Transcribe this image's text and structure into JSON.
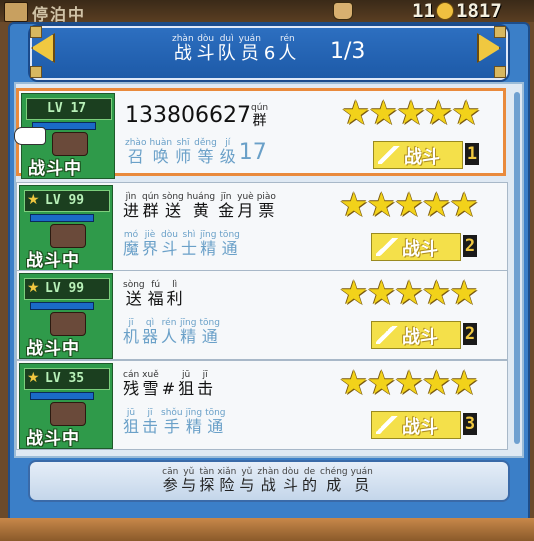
{
  "topbar": {
    "title": "停泊中",
    "count1": "11",
    "count2": "1817"
  },
  "header": {
    "title": [
      {
        "py": "zhàn",
        "hz": "战"
      },
      {
        "py": "dòu",
        "hz": "斗"
      },
      {
        "py": "duì",
        "hz": "队"
      },
      {
        "py": "yuán",
        "hz": "员"
      },
      {
        "py": "",
        "hz": "6"
      },
      {
        "py": "rén",
        "hz": "人"
      }
    ],
    "page": "1/3"
  },
  "members": [
    {
      "level": "LV 17",
      "battle_tag": "战斗中",
      "name_plain": "133806627",
      "name": [
        {
          "py": "qún",
          "hz": "群"
        }
      ],
      "job": [
        {
          "py": "zhào",
          "hz": "召"
        },
        {
          "py": "huàn",
          "hz": "唤"
        },
        {
          "py": "shī",
          "hz": "师"
        },
        {
          "py": "děng",
          "hz": "等"
        },
        {
          "py": "jí",
          "hz": "级"
        }
      ],
      "job_level": "17",
      "stars": 5,
      "fight_label": "战斗",
      "slot": "1",
      "selected": true
    },
    {
      "level": "LV 99",
      "battle_tag": "战斗中",
      "name_plain": "",
      "name": [
        {
          "py": "jìn",
          "hz": "进"
        },
        {
          "py": "qún",
          "hz": "群"
        },
        {
          "py": "sòng",
          "hz": "送"
        },
        {
          "py": "huáng",
          "hz": "黄"
        },
        {
          "py": "jīn",
          "hz": "金"
        },
        {
          "py": "yuè",
          "hz": "月"
        },
        {
          "py": "piào",
          "hz": "票"
        }
      ],
      "job": [
        {
          "py": "mó",
          "hz": "魔"
        },
        {
          "py": "jiè",
          "hz": "界"
        },
        {
          "py": "dòu",
          "hz": "斗"
        },
        {
          "py": "shì",
          "hz": "士"
        },
        {
          "py": "jīng",
          "hz": "精"
        },
        {
          "py": "tōng",
          "hz": "通"
        }
      ],
      "job_level": "",
      "stars": 5,
      "fight_label": "战斗",
      "slot": "2",
      "selected": false
    },
    {
      "level": "LV 99",
      "battle_tag": "战斗中",
      "name_plain": "",
      "name": [
        {
          "py": "sòng",
          "hz": "送"
        },
        {
          "py": "fú",
          "hz": "福"
        },
        {
          "py": "lì",
          "hz": "利"
        }
      ],
      "job": [
        {
          "py": "jī",
          "hz": "机"
        },
        {
          "py": "qì",
          "hz": "器"
        },
        {
          "py": "rén",
          "hz": "人"
        },
        {
          "py": "jīng",
          "hz": "精"
        },
        {
          "py": "tōng",
          "hz": "通"
        }
      ],
      "job_level": "",
      "stars": 5,
      "fight_label": "战斗",
      "slot": "2",
      "selected": false
    },
    {
      "level": "LV 35",
      "battle_tag": "战斗中",
      "name_plain": "",
      "name": [
        {
          "py": "cán",
          "hz": "残"
        },
        {
          "py": "xuě",
          "hz": "雪"
        },
        {
          "py": "",
          "hz": "#"
        },
        {
          "py": "jū",
          "hz": "狙"
        },
        {
          "py": "jī",
          "hz": "击"
        }
      ],
      "job": [
        {
          "py": "jū",
          "hz": "狙"
        },
        {
          "py": "jī",
          "hz": "击"
        },
        {
          "py": "shǒu",
          "hz": "手"
        },
        {
          "py": "jīng",
          "hz": "精"
        },
        {
          "py": "tōng",
          "hz": "通"
        }
      ],
      "job_level": "",
      "stars": 5,
      "fight_label": "战斗",
      "slot": "3",
      "selected": false
    }
  ],
  "footer": [
    {
      "py": "cān",
      "hz": "参"
    },
    {
      "py": "yǔ",
      "hz": "与"
    },
    {
      "py": "tàn",
      "hz": "探"
    },
    {
      "py": "xiǎn",
      "hz": "险"
    },
    {
      "py": "yǔ",
      "hz": "与"
    },
    {
      "py": "zhàn",
      "hz": "战"
    },
    {
      "py": "dòu",
      "hz": "斗"
    },
    {
      "py": "de",
      "hz": "的"
    },
    {
      "py": "chéng",
      "hz": "成"
    },
    {
      "py": "yuán",
      "hz": "员"
    }
  ],
  "icons": {
    "prev": "arrow-left-icon",
    "next": "arrow-right-icon",
    "star": "star-icon",
    "sword": "sword-icon",
    "pointer": "hand-pointer-icon"
  },
  "colors": {
    "frame": "#3b7fc8",
    "selected_border": "#e98a3c",
    "star": "#f2d21a",
    "fight_button": "#f4e04a",
    "portrait_bg": "#2f9a4a"
  }
}
